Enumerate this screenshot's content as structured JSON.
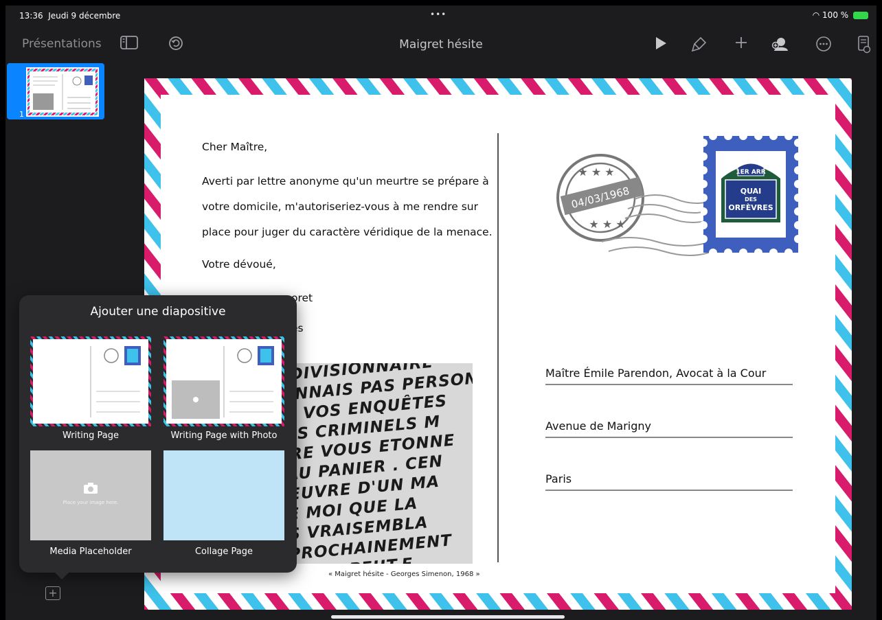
{
  "status": {
    "time": "13:36",
    "date": "Jeudi 9 décembre",
    "dots": "•••",
    "wifi": "",
    "battery": "100 %"
  },
  "toolbar": {
    "presentations_label": "Présentations",
    "doc_title": "Maigret hésite",
    "icons": [
      "sidebar-icon",
      "undo-icon",
      "play-icon",
      "format-brush-icon",
      "add-icon",
      "collaborate-icon",
      "more-icon",
      "document-icon"
    ]
  },
  "sidebar": {
    "slide_number": "1"
  },
  "slide": {
    "greeting": "Cher Maître,",
    "body_line1": "Averti par lettre anonyme qu'un meurtre se prépare à",
    "body_line2": "votre domicile, m'autoriseriez-vous à me rendre sur",
    "body_line3": "place pour juger du caractère véridique de la menace.",
    "closing": "Votre dévoué,",
    "signature_partial": "oret",
    "signature_partial2": "es",
    "address_line1": "Maître Émile Parendon, Avocat à la Cour",
    "address_line2": "Avenue de Marigny",
    "address_line3": "Paris",
    "caption": "« Maigret hésite - Georges Simenon, 1968 »",
    "postmark_date": "04/03/1968",
    "stamp_top": "1ER ARR",
    "stamp_line1": "QUAI",
    "stamp_line2": "DES",
    "stamp_line3": "ORFÈVRES",
    "photo_lines": [
      "R LEDIVISIONNAIRE",
      "S CONNAIS PAS PERSON",
      "U DE VOS ENQUÊTES",
      "S DES CRIMINELS M",
      "ETTRE VOUS ETONNE",
      "TE AU PANIER . CEN",
      "IL'ŒUVRE D'UN MA",
      "QUE MOI QUE LA",
      "URS VRAISEMBLA",
      "IS PROCHAINEMENT",
      "E.JOURS PEUT.E"
    ]
  },
  "popover": {
    "title": "Ajouter une diapositive",
    "templates": [
      {
        "label": "Writing Page"
      },
      {
        "label": "Writing Page with Photo"
      },
      {
        "label": "Media Placeholder",
        "hint": "Place your image here."
      },
      {
        "label": "Collage Page"
      }
    ]
  },
  "colors": {
    "airmail_red": "#d81b6a",
    "airmail_blue": "#3ec1ea",
    "stamp_blue": "#3f5fbf",
    "accent": "#0a84ff"
  }
}
